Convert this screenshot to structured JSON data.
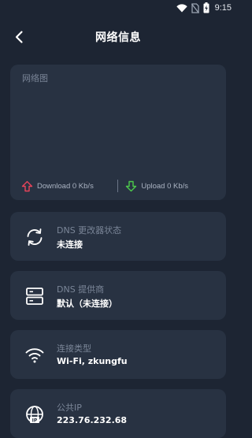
{
  "status_bar": {
    "time": "9:15",
    "icons": [
      "wifi-icon",
      "no-sim-icon",
      "battery-charging-icon"
    ]
  },
  "app_bar": {
    "title": "网络信息",
    "back_icon": "back-arrow-icon"
  },
  "graph": {
    "label": "网络图",
    "download": "Download 0 Kb/s",
    "upload": "Upload 0 Kb/s"
  },
  "info_items": [
    {
      "icon": "refresh-icon",
      "label": "DNS 更改器状态",
      "value": "未连接"
    },
    {
      "icon": "server-icon",
      "label": "DNS 提供商",
      "value": "默认（未连接）"
    },
    {
      "icon": "wifi-icon",
      "label": "连接类型",
      "value": "Wi-Fi, zkungfu"
    },
    {
      "icon": "globe-ip-icon",
      "label": "公共IP",
      "value": "223.76.232.68"
    }
  ],
  "colors": {
    "background": "#1d2533",
    "card": "#283242",
    "download_arrow": "#e8445a",
    "upload_arrow": "#4cc94c"
  }
}
